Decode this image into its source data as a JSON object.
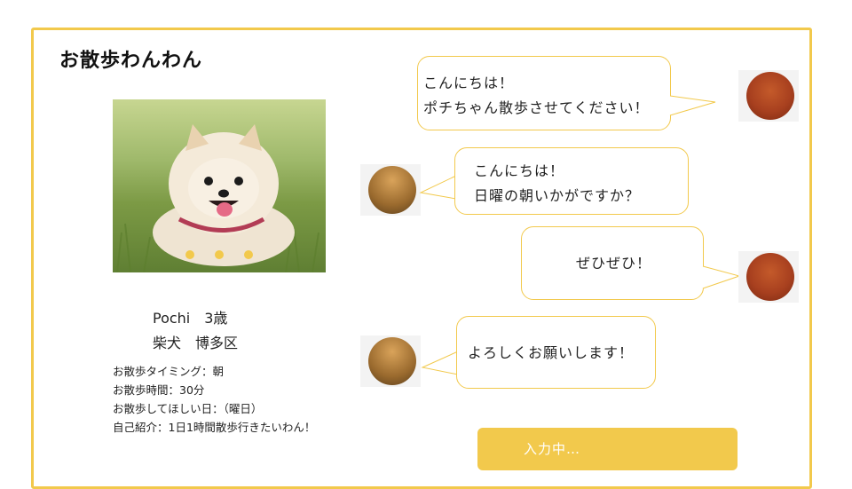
{
  "app": {
    "title": "お散歩わんわん"
  },
  "dog": {
    "name_age": "Pochi　3歳",
    "breed_area": "柴犬　博多区",
    "details": [
      "お散歩タイミング：朝",
      "お散歩時間：30分",
      "お散歩してほしい日：（曜日）",
      "自己紹介：1日1時間散歩行きたいわん！"
    ],
    "carousel_pages": 3
  },
  "chat": {
    "messages": [
      {
        "sender": "owner",
        "lines": [
          "こんにちは！",
          "ポチちゃん散歩させてください！"
        ]
      },
      {
        "sender": "walker",
        "lines": [
          "こんにちは！",
          "日曜の朝いかがですか？"
        ]
      },
      {
        "sender": "owner",
        "lines": [
          "ぜひぜひ！"
        ]
      },
      {
        "sender": "walker",
        "lines": [
          "よろしくお願いします！"
        ]
      }
    ]
  },
  "input": {
    "status": "入力中…"
  },
  "colors": {
    "accent": "#f2c94c"
  }
}
